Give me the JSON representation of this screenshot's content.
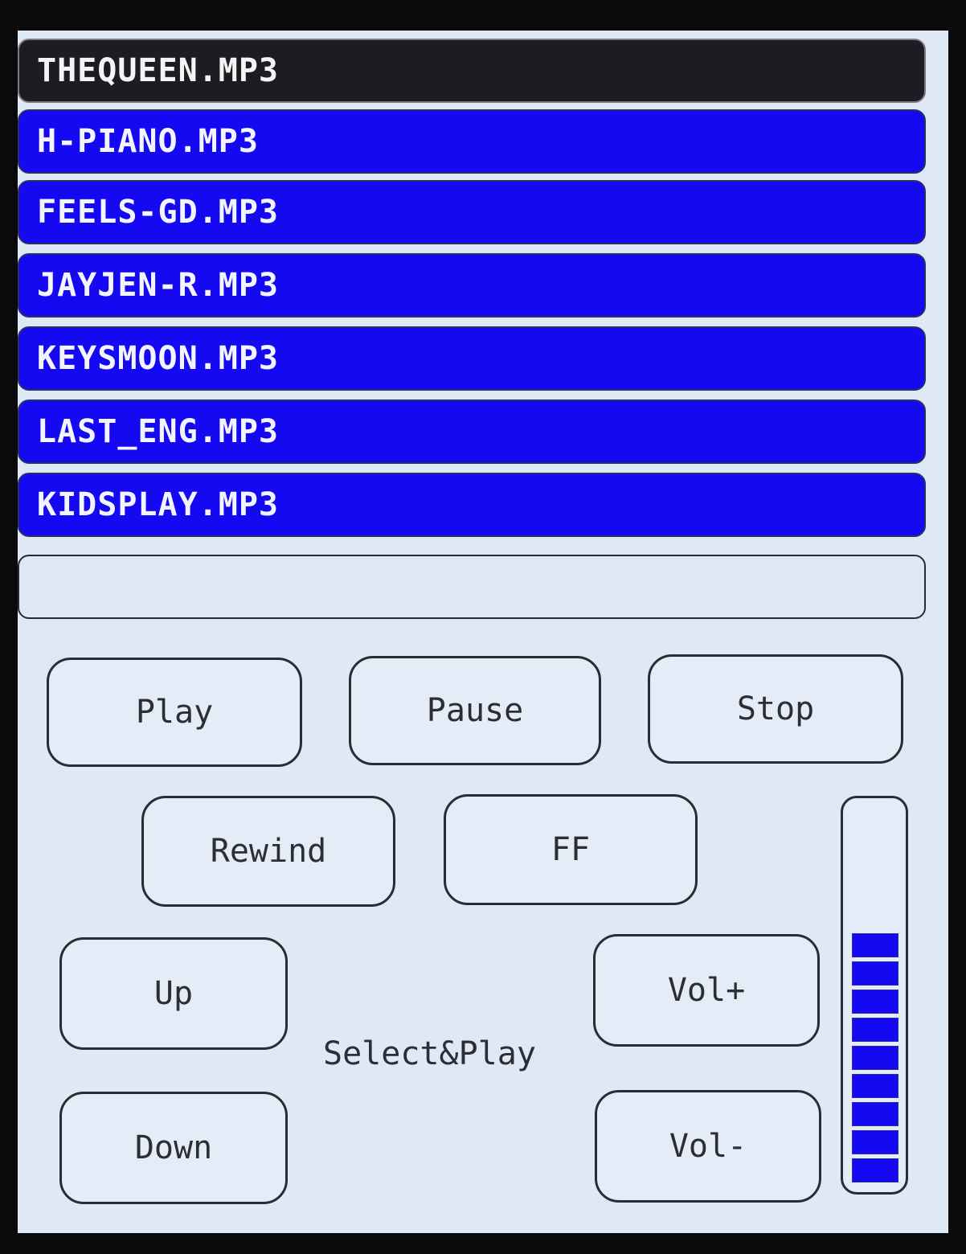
{
  "playlist": {
    "tracks": [
      {
        "name": "THEQUEEN.MP3",
        "selected": true
      },
      {
        "name": "H-PIANO.MP3",
        "selected": false
      },
      {
        "name": "FEELS-GD.MP3",
        "selected": false
      },
      {
        "name": "JAYJEN-R.MP3",
        "selected": false
      },
      {
        "name": "KEYSMOON.MP3",
        "selected": false
      },
      {
        "name": "LAST_ENG.MP3",
        "selected": false
      },
      {
        "name": "KIDSPLAY.MP3",
        "selected": false
      }
    ]
  },
  "controls": {
    "play": "Play",
    "pause": "Pause",
    "stop": "Stop",
    "rewind": "Rewind",
    "ff": "FF",
    "up": "Up",
    "down": "Down",
    "vol_up": "Vol+",
    "vol_down": "Vol-",
    "select_play": "Select&Play"
  },
  "volume": {
    "level_segments": 9,
    "max_segments": 16
  },
  "colors": {
    "accent": "#1409f0",
    "selected": "#1c1c22",
    "screen_bg": "#dfe9f5"
  }
}
